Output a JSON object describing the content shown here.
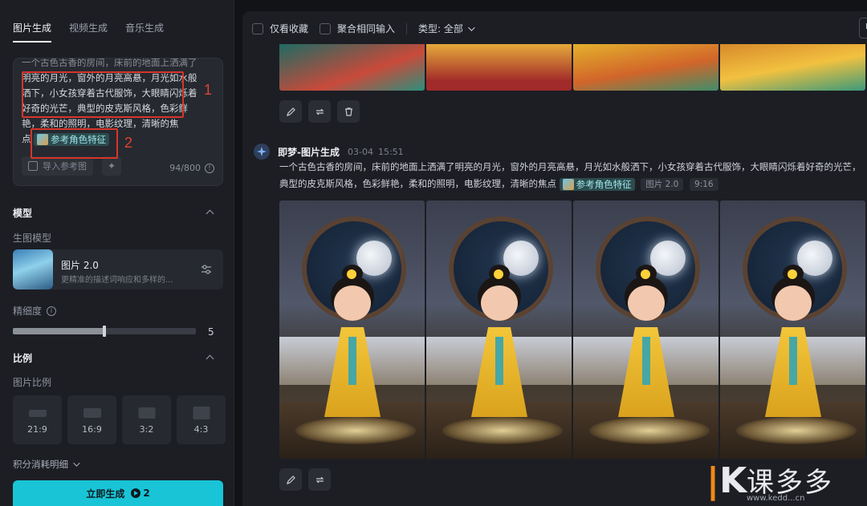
{
  "left_panel": {
    "tabs": [
      {
        "label": "图片生成",
        "active": true
      },
      {
        "label": "视频生成",
        "active": false
      },
      {
        "label": "音乐生成",
        "active": false
      }
    ],
    "prompt": {
      "line0": "一个古色古香的房间，床前的地面上洒满了",
      "line1": "明亮的月光，窗外的月亮高悬，月光如水般",
      "line2": "洒下，小女孩穿着古代服饰，大眼睛闪烁着",
      "line3": "好奇的光芒，典型的皮克斯风格，色彩鲜",
      "line4": "艳，柔和的照明，电影纹理，清晰的焦",
      "line5_prefix": "点",
      "ref_chip": "参考角色特征",
      "upload_label": "导入参考图",
      "counter": "94/800"
    },
    "annotations": {
      "box1": "1",
      "box2": "2"
    },
    "model_section": {
      "title": "模型",
      "sub": "生图模型",
      "model_name": "图片 2.0",
      "model_desc": "更精准的描述词响应和多样的..."
    },
    "detail": {
      "label": "精细度",
      "value": "5",
      "level_fraction": 0.5
    },
    "ratio_section": {
      "title": "比例",
      "sub": "图片比例",
      "options": [
        "21:9",
        "16:9",
        "3:2",
        "4:3"
      ]
    },
    "credits": "积分消耗明细",
    "generate": {
      "label": "立即生成",
      "cost": "2"
    }
  },
  "right_panel": {
    "toolbar": {
      "fav_only": "仅看收藏",
      "merge_same": "聚合相同输入",
      "type_label": "类型: 全部",
      "corner": "B"
    },
    "generation": {
      "name": "即梦-图片生成",
      "date": "03-04",
      "time": "15:51",
      "prompt": "一个古色古香的房间，床前的地面上洒满了明亮的月光，窗外的月亮高悬，月光如水般洒下，小女孩穿着古代服饰，大眼睛闪烁着好奇的光芒，典型的皮克斯风格，色彩鲜艳，柔和的照明，电影纹理，清晰的焦点",
      "ref_chip": "参考角色特征",
      "model_tag": "图片 2.0",
      "ratio_tag": "9:16"
    }
  },
  "watermark": {
    "logo": "K",
    "text": "课多多",
    "url": "www.kedd...cn"
  },
  "colors": {
    "accent": "#19c4d6",
    "annotation": "#d7352b",
    "panel": "#1c1e24",
    "background": "#121317"
  }
}
